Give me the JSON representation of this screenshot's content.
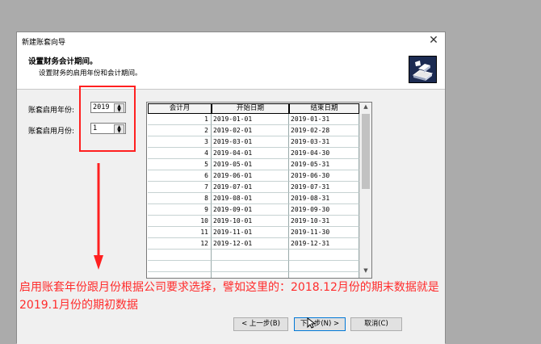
{
  "dialog": {
    "title": "新建账套向导",
    "header_title": "设置财务会计期间。",
    "header_subtitle": "设置财务的启用年份和会计期间。",
    "close_icon": "close-icon",
    "logo_icon": "wizard-logo-icon"
  },
  "form": {
    "year_label": "账套启用年份:",
    "year_value": "2019",
    "month_label": "账套启用月份:",
    "month_value": "1"
  },
  "table": {
    "headers": [
      "会计月",
      "开始日期",
      "结束日期"
    ],
    "rows": [
      [
        "1",
        "2019-01-01",
        "2019-01-31"
      ],
      [
        "2",
        "2019-02-01",
        "2019-02-28"
      ],
      [
        "3",
        "2019-03-01",
        "2019-03-31"
      ],
      [
        "4",
        "2019-04-01",
        "2019-04-30"
      ],
      [
        "5",
        "2019-05-01",
        "2019-05-31"
      ],
      [
        "6",
        "2019-06-01",
        "2019-06-30"
      ],
      [
        "7",
        "2019-07-01",
        "2019-07-31"
      ],
      [
        "8",
        "2019-08-01",
        "2019-08-31"
      ],
      [
        "9",
        "2019-09-01",
        "2019-09-30"
      ],
      [
        "10",
        "2019-10-01",
        "2019-10-31"
      ],
      [
        "11",
        "2019-11-01",
        "2019-11-30"
      ],
      [
        "12",
        "2019-12-01",
        "2019-12-31"
      ]
    ]
  },
  "buttons": {
    "prev": "< 上一步(B)",
    "next": "下一步(N) >",
    "cancel": "取消(C)"
  },
  "annotation": {
    "line1": "启用账套年份跟月份根据公司要求选择，譬如这里的：2018.12月份的期末数据就是",
    "line2": "2019.1月份的期初数据",
    "color": "#ff2c2c"
  }
}
